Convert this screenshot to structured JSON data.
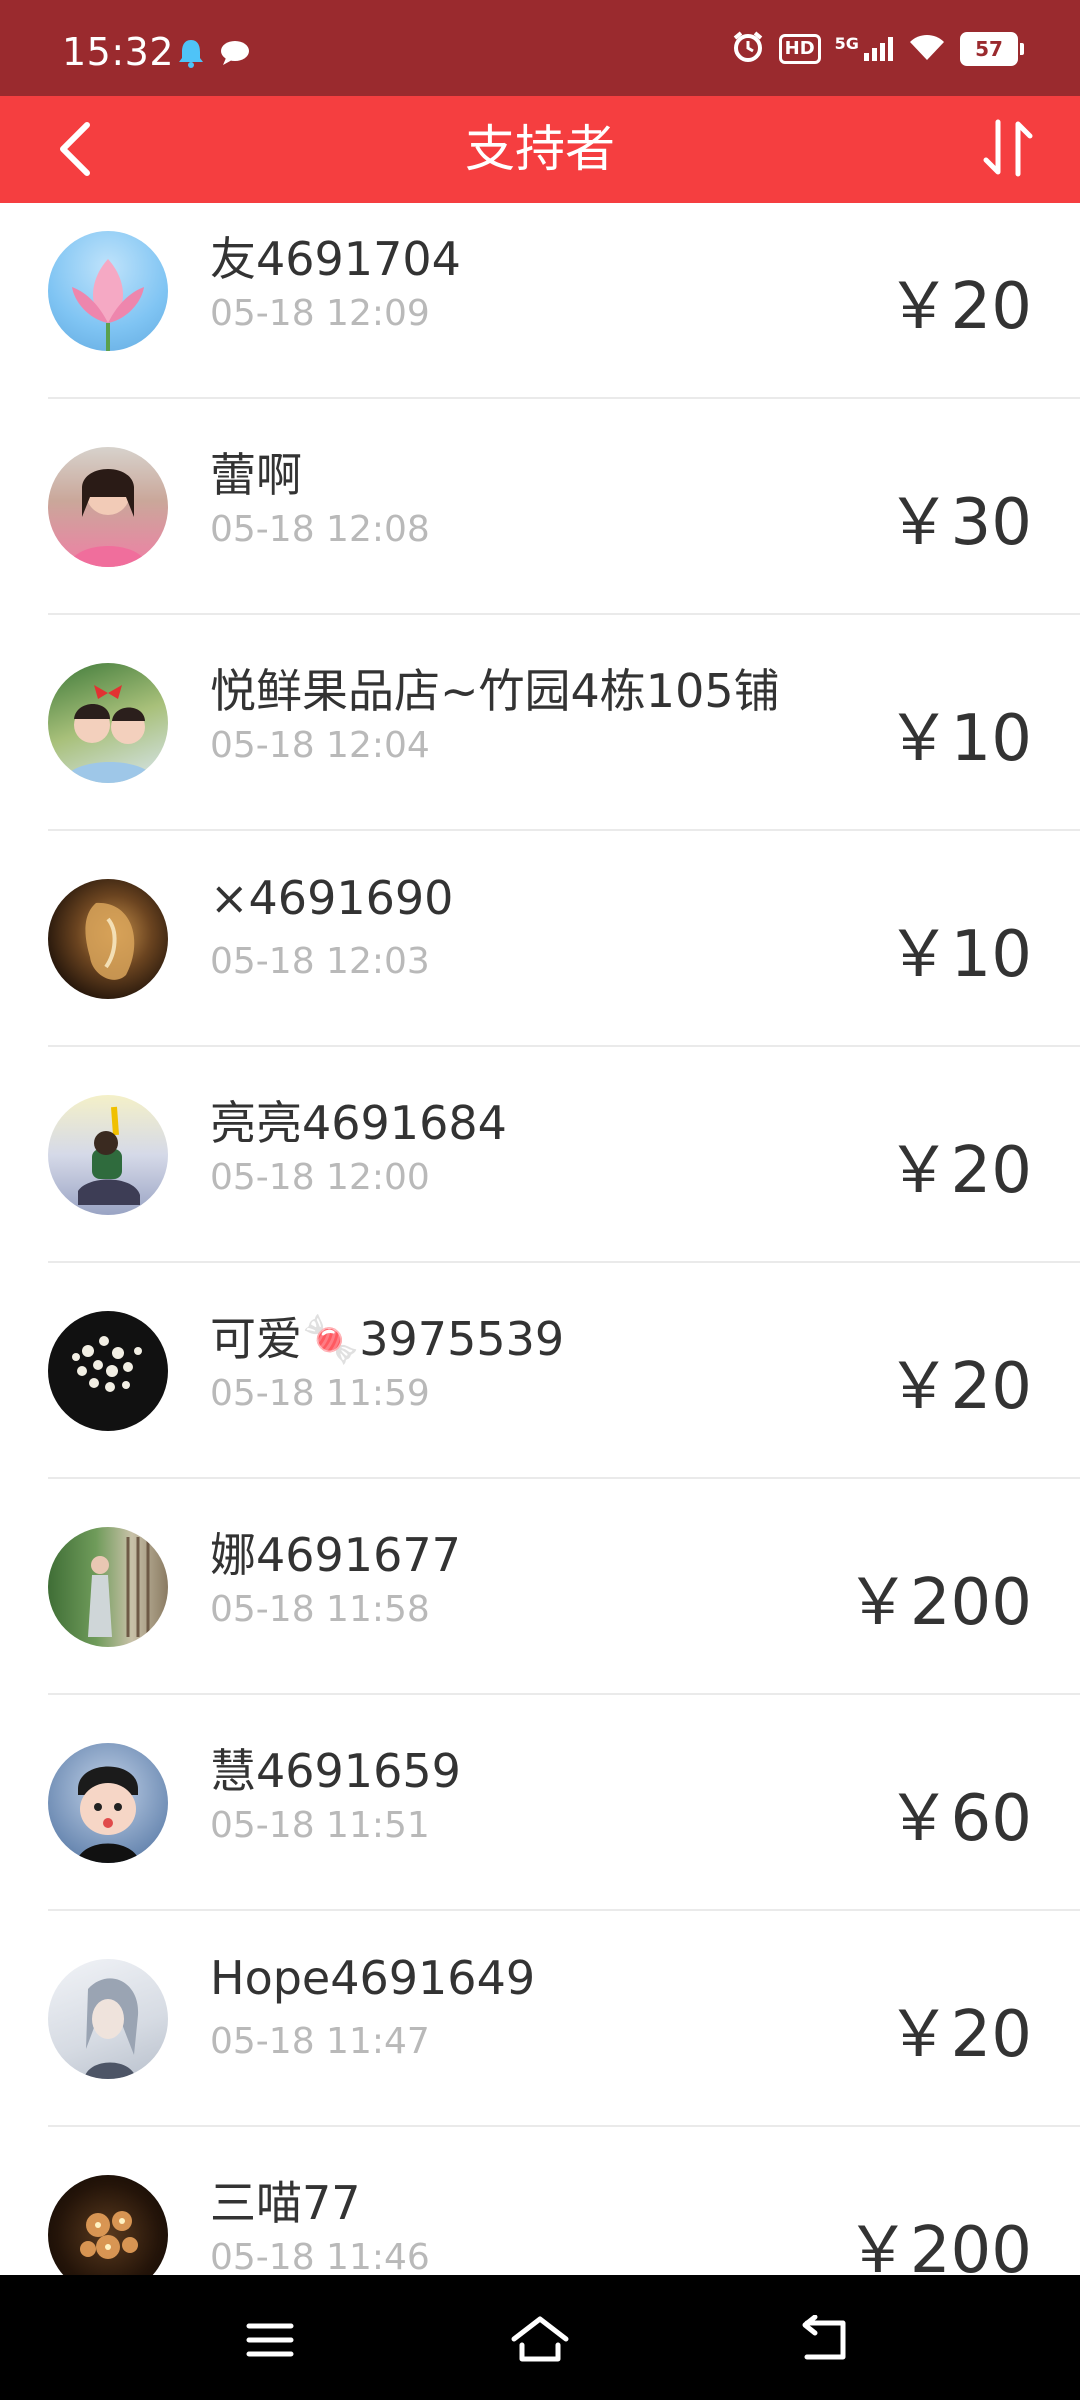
{
  "status_bar": {
    "time": "15:32",
    "network": "5G",
    "hd": "HD",
    "battery": "57",
    "icons": [
      "notification-bell-icon",
      "chat-bubble-icon",
      "alarm-icon",
      "hd-icon",
      "signal-icon",
      "wifi-icon",
      "battery-icon"
    ]
  },
  "header": {
    "title": "支持者",
    "back_icon": "chevron-left-icon",
    "sort_icon": "sort-arrows-icon",
    "background": "#f53e40"
  },
  "supporters": [
    {
      "name": "友4691704",
      "time": "05-18 12:09",
      "amount": "￥20"
    },
    {
      "name": "蕾啊",
      "time": "05-18 12:08",
      "amount": "￥30"
    },
    {
      "name": "悦鲜果品店~竹园4栋105铺",
      "time": "05-18 12:04",
      "amount": "￥10"
    },
    {
      "name": "×4691690",
      "time": "05-18 12:03",
      "amount": "￥10"
    },
    {
      "name": "亮亮4691684",
      "time": "05-18 12:00",
      "amount": "￥20"
    },
    {
      "name": "可爱🍬3975539",
      "time": "05-18 11:59",
      "amount": "￥20"
    },
    {
      "name": "娜4691677",
      "time": "05-18 11:58",
      "amount": "￥200"
    },
    {
      "name": "慧4691659",
      "time": "05-18 11:51",
      "amount": "￥60"
    },
    {
      "name": "Hope4691649",
      "time": "05-18 11:47",
      "amount": "￥20"
    },
    {
      "name": "三喵77",
      "time": "05-18 11:46",
      "amount": "￥200"
    }
  ],
  "nav_bar": {
    "icons": [
      "menu-icon",
      "home-icon",
      "back-icon"
    ]
  }
}
